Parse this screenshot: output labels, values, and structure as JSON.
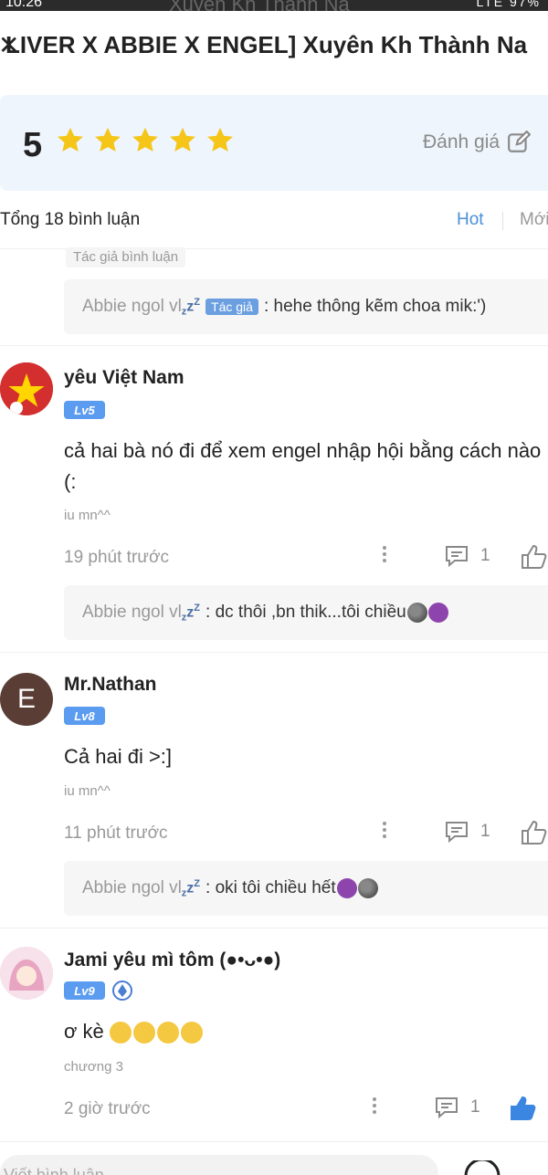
{
  "statusbar": {
    "time": "10:26",
    "title": "Xuyên Kh Thành Nạ",
    "right": "LTE 97%"
  },
  "header": {
    "close": "✕",
    "title": "LIVER X ABBIE X ENGEL] Xuyên Kh Thành Na"
  },
  "rating": {
    "score": "5",
    "stars": 5,
    "rate_label": "Đánh giá"
  },
  "comments_header": {
    "total": "Tổng 18 bình luận",
    "tab_hot": "Hot",
    "tab_new": "Mới"
  },
  "pinned_reply": {
    "chip": "Tác giả bình luận",
    "name": "Abbie ngol vl",
    "author_tag": "Tác giả",
    "text": ": hehe thông kẽm choa mik:')"
  },
  "comments": [
    {
      "username": "yêu Việt Nam",
      "level": "Lv5",
      "content_line1": "cả hai bà nó đi để xem engel nhập hội bằng cách nào",
      "content_line2": "(:",
      "chapter": "iu mn^^",
      "time": "19 phút trước",
      "replies": "1",
      "reply": {
        "name": "Abbie ngol vl",
        "text": ": dc thôi ,bn thik...tôi chiều"
      }
    },
    {
      "username": "Mr.Nathan",
      "avatar_letter": "E",
      "level": "Lv8",
      "content_line1": "Cả hai đi >:]",
      "chapter": "iu mn^^",
      "time": "11 phút trước",
      "replies": "1",
      "reply": {
        "name": "Abbie ngol vl",
        "text": ": oki tôi chiều hết"
      }
    },
    {
      "username": "Jami yêu mì tôm (●•ᴗ•●)",
      "level": "Lv9",
      "content_line1": "ơ kè",
      "chapter": "chương 3",
      "time": "2 giờ trước",
      "replies": "1"
    }
  ],
  "bottom": {
    "placeholder": "Viết bình luận"
  },
  "colors": {
    "accent": "#4a90d9",
    "star": "#f5c518",
    "level_badge": "#5b9cf0",
    "rating_bg": "#eef5fc"
  }
}
